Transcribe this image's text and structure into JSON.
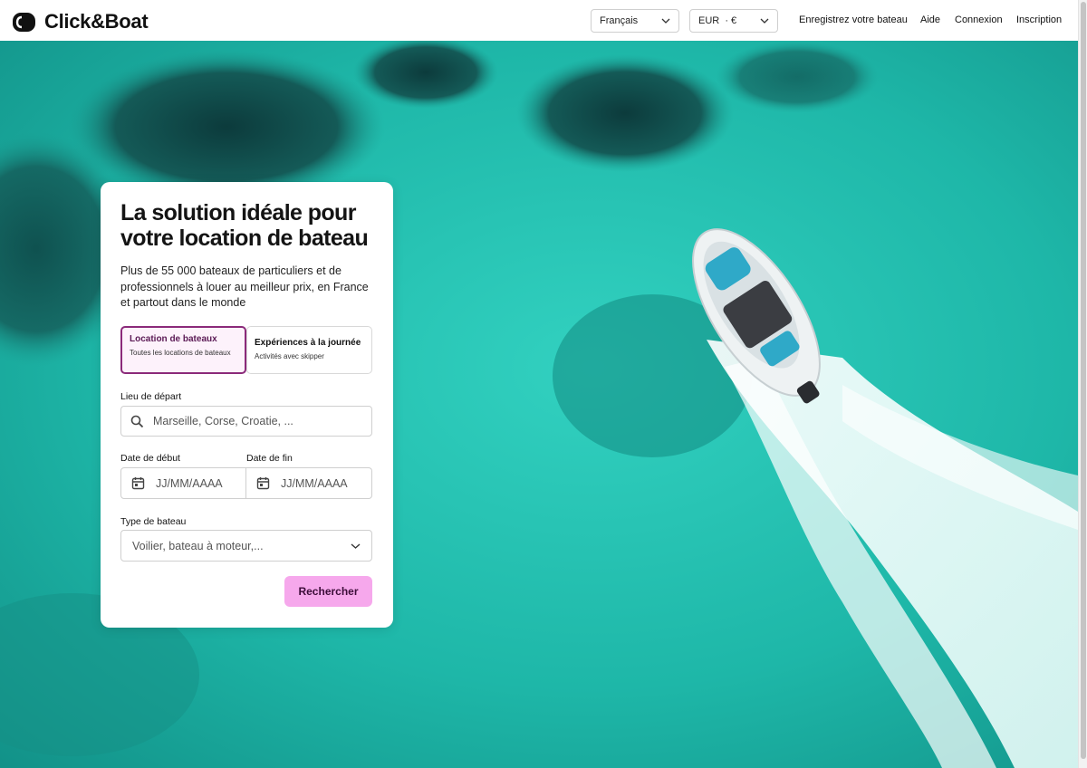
{
  "header": {
    "brand": "Click&Boat",
    "language": "Français",
    "currency": "EUR  · €",
    "nav": {
      "register_boat": "Enregistrez votre bateau",
      "help": "Aide",
      "login": "Connexion",
      "signup": "Inscription"
    }
  },
  "hero": {
    "title": "La solution idéale pour votre location de bateau",
    "description": "Plus de 55 000 bateaux de particuliers et de professionnels à louer au meilleur prix, en France et partout dans le monde",
    "tabs": [
      {
        "label": "Location de bateaux",
        "sublabel": "Toutes les locations de bateaux",
        "active": true
      },
      {
        "label": "Expériences à la journée",
        "sublabel": "Activités avec skipper",
        "active": false
      }
    ],
    "form": {
      "place_label": "Lieu de départ",
      "place_placeholder": "Marseille, Corse, Croatie, ...",
      "start_label": "Date de début",
      "start_placeholder": "JJ/MM/AAAA",
      "end_label": "Date de fin",
      "end_placeholder": "JJ/MM/AAAA",
      "type_label": "Type de bateau",
      "type_placeholder": "Voilier, bateau à moteur,...",
      "submit": "Rechercher"
    }
  },
  "colors": {
    "accent_button": "#f6a8ec",
    "active_tab_border": "#8b2a7a",
    "sea": "#1fb8a8"
  },
  "icons": [
    "brand-logo-icon",
    "chevron-down-icon",
    "search-icon",
    "calendar-icon"
  ]
}
